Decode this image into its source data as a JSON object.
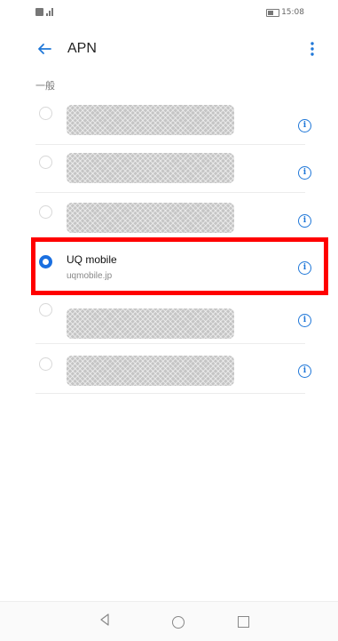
{
  "status_bar": {
    "time": "15:08",
    "icons": [
      "sim-icon",
      "signal-icon",
      "battery-icon"
    ]
  },
  "app_bar": {
    "title": "APN",
    "back_icon": "arrow-left-icon",
    "menu_icon": "overflow-menu-icon"
  },
  "section": {
    "header": "一般"
  },
  "apn_list": [
    {
      "name": "",
      "apn": "",
      "selected": false,
      "redacted": true
    },
    {
      "name": "",
      "apn": "",
      "selected": false,
      "redacted": true
    },
    {
      "name": "",
      "apn": "",
      "selected": false,
      "redacted": true
    },
    {
      "name": "UQ mobile",
      "apn": "uqmobile.jp",
      "selected": true,
      "redacted": false
    },
    {
      "name": "",
      "apn": "",
      "selected": false,
      "redacted": true
    },
    {
      "name": "",
      "apn": "",
      "selected": false,
      "redacted": true
    }
  ],
  "info_icon_glyph": "i",
  "nav_bar": {
    "icons": [
      "nav-back-icon",
      "nav-home-icon",
      "nav-recent-icon"
    ]
  },
  "colors": {
    "accent": "#1f77d8",
    "radio_selected": "#1a6fe0",
    "highlight": "#ff0000"
  }
}
